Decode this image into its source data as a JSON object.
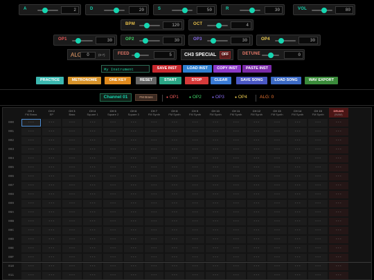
{
  "sliders_row1": [
    {
      "id": "a",
      "label": "A",
      "value": "2",
      "fill": 0.35,
      "color": "#16d6b1"
    },
    {
      "id": "d",
      "label": "D",
      "value": "20",
      "fill": 0.6,
      "color": "#16d6b1"
    },
    {
      "id": "s",
      "label": "S",
      "value": "50",
      "fill": 0.62,
      "color": "#16d6b1"
    },
    {
      "id": "r",
      "label": "R",
      "value": "30",
      "fill": 0.6,
      "color": "#16d6b1"
    },
    {
      "id": "vol",
      "label": "VOL",
      "value": "80",
      "fill": 0.6,
      "color": "#16d6b1"
    }
  ],
  "sliders_row2": [
    {
      "id": "bpm",
      "label": "BPM",
      "value": "120",
      "fill": 0.35,
      "color": "#e8c04a"
    },
    {
      "id": "oct",
      "label": "OCT",
      "value": "4",
      "fill": 0.55,
      "color": "#e8c04a"
    }
  ],
  "sliders_row3": [
    {
      "id": "op1",
      "label": "OP1",
      "value": "30",
      "fill": 0.3,
      "color": "#ef5a5a"
    },
    {
      "id": "op2",
      "label": "OP2",
      "value": "30",
      "fill": 0.3,
      "color": "#42d86b"
    },
    {
      "id": "op3",
      "label": "OP3",
      "value": "30",
      "fill": 0.3,
      "color": "#8a6cf0"
    },
    {
      "id": "op4",
      "label": "OP4",
      "value": "30",
      "fill": 0.3,
      "color": "#f2d052"
    }
  ],
  "alg": {
    "label": "ALG:",
    "value": "0",
    "hint": "(0-7)"
  },
  "feed": {
    "label": "FEED",
    "value": "5",
    "fill": 0.3
  },
  "ch3": {
    "label": "CH3 SPECIAL",
    "toggle": "OFF"
  },
  "detune": {
    "label": "DETUNE",
    "value": "0",
    "fill": 0.5
  },
  "instrument": {
    "name": "My Instrument",
    "save": "SAVE INST",
    "load": "LOAD INST",
    "copy": "COPY INST",
    "paste": "PASTE INST"
  },
  "transport": [
    {
      "id": "practice",
      "label": "PRACTICE",
      "color": "#3cb8b0"
    },
    {
      "id": "metronome",
      "label": "METRONOME",
      "color": "#d6922a"
    },
    {
      "id": "one-key",
      "label": "ONE KEY",
      "color": "#e08a1e"
    },
    {
      "id": "reset",
      "label": "RESET",
      "color": "#666666"
    },
    {
      "id": "start",
      "label": "START",
      "color": "#2aa585"
    },
    {
      "id": "stop",
      "label": "STOP",
      "color": "#d63a3a"
    },
    {
      "id": "clear",
      "label": "CLEAR",
      "color": "#3a7bd6"
    },
    {
      "id": "save-song",
      "label": "SAVE SONG",
      "color": "#4a58c4"
    },
    {
      "id": "load-song",
      "label": "LOAD SONG",
      "color": "#3c6ac4"
    },
    {
      "id": "wav-export",
      "label": "WAV EXPORT",
      "color": "#3a8a3a"
    }
  ],
  "channel_bar": {
    "channel": "Channel 01",
    "instrument": "FM Brass",
    "ops": [
      {
        "label": "OP1",
        "color": "#ef5a5a"
      },
      {
        "label": "OP2",
        "color": "#42d86b"
      },
      {
        "label": "OP3",
        "color": "#8a6cf0"
      },
      {
        "label": "OP4",
        "color": "#f2d052"
      }
    ],
    "alg": "ALG: 0"
  },
  "grid": {
    "columns": [
      {
        "name": "CH 1",
        "sub": "FM Brass"
      },
      {
        "name": "CH 2",
        "sub": "EP"
      },
      {
        "name": "CH 3",
        "sub": "Bass"
      },
      {
        "name": "CH 4",
        "sub": "Square 1"
      },
      {
        "name": "CH 5",
        "sub": "Square 2"
      },
      {
        "name": "CH 6",
        "sub": "Square 3"
      },
      {
        "name": "CH 7",
        "sub": "FM Synth"
      },
      {
        "name": "CH 8",
        "sub": "FM Synth"
      },
      {
        "name": "CH 9",
        "sub": "FM Synth"
      },
      {
        "name": "CH 10",
        "sub": "FM Synth"
      },
      {
        "name": "CH 11",
        "sub": "FM Synth"
      },
      {
        "name": "CH 12",
        "sub": "FM Synth"
      },
      {
        "name": "CH 13",
        "sub": "FM Synth"
      },
      {
        "name": "CH 14",
        "sub": "FM Synth"
      },
      {
        "name": "CH 15",
        "sub": "FM Synth"
      },
      {
        "name": "DRUMS",
        "sub": "(NAM)"
      }
    ],
    "rows": [
      "000",
      "001",
      "002",
      "003",
      "004",
      "005",
      "006",
      "007",
      "008",
      "009",
      "00A",
      "00B",
      "00C",
      "00D",
      "00E",
      "00F",
      "010",
      "011"
    ],
    "empty": "---"
  }
}
